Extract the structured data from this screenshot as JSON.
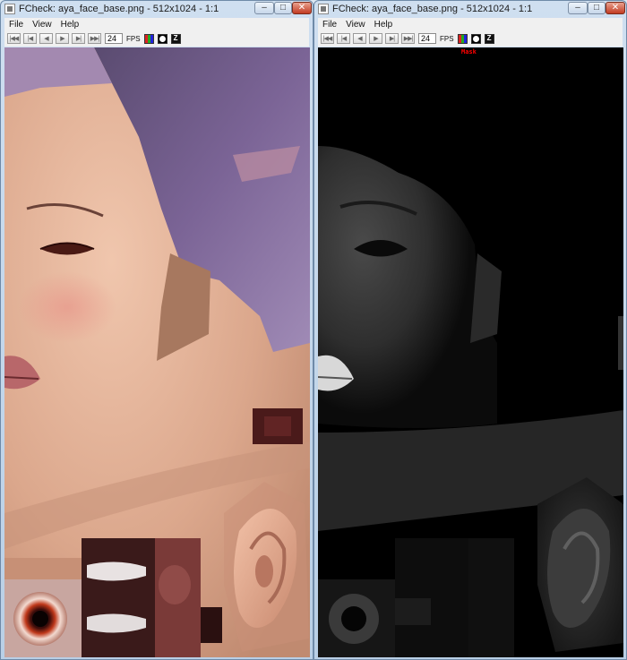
{
  "windows": [
    {
      "title": "FCheck: aya_face_base.png - 512x1024 - 1:1",
      "menu": [
        "File",
        "View",
        "Help"
      ],
      "toolbar": {
        "buttons": [
          "first-frame",
          "step-back",
          "play-back",
          "play-forward",
          "step-forward",
          "last-frame"
        ],
        "fps_value": "24",
        "fps_label": "FPS",
        "tool_icons": [
          "rgb-channel-icon",
          "alpha-channel-icon",
          "z-depth-icon"
        ]
      },
      "view": "rgb"
    },
    {
      "title": "FCheck: aya_face_base.png - 512x1024 - 1:1",
      "menu": [
        "File",
        "View",
        "Help"
      ],
      "toolbar": {
        "buttons": [
          "first-frame",
          "step-back",
          "play-back",
          "play-forward",
          "step-forward",
          "last-frame"
        ],
        "fps_value": "24",
        "fps_label": "FPS",
        "tool_icons": [
          "rgb-channel-icon",
          "alpha-channel-icon",
          "z-depth-icon"
        ]
      },
      "view": "alpha",
      "channel_label": "Mask"
    }
  ],
  "colors": {
    "titlebar": "#c4d7ec",
    "skin": "#d9a48a",
    "hair": "#6f5a86",
    "close_button": "#c23b22",
    "mask_label": "#ff0000"
  }
}
